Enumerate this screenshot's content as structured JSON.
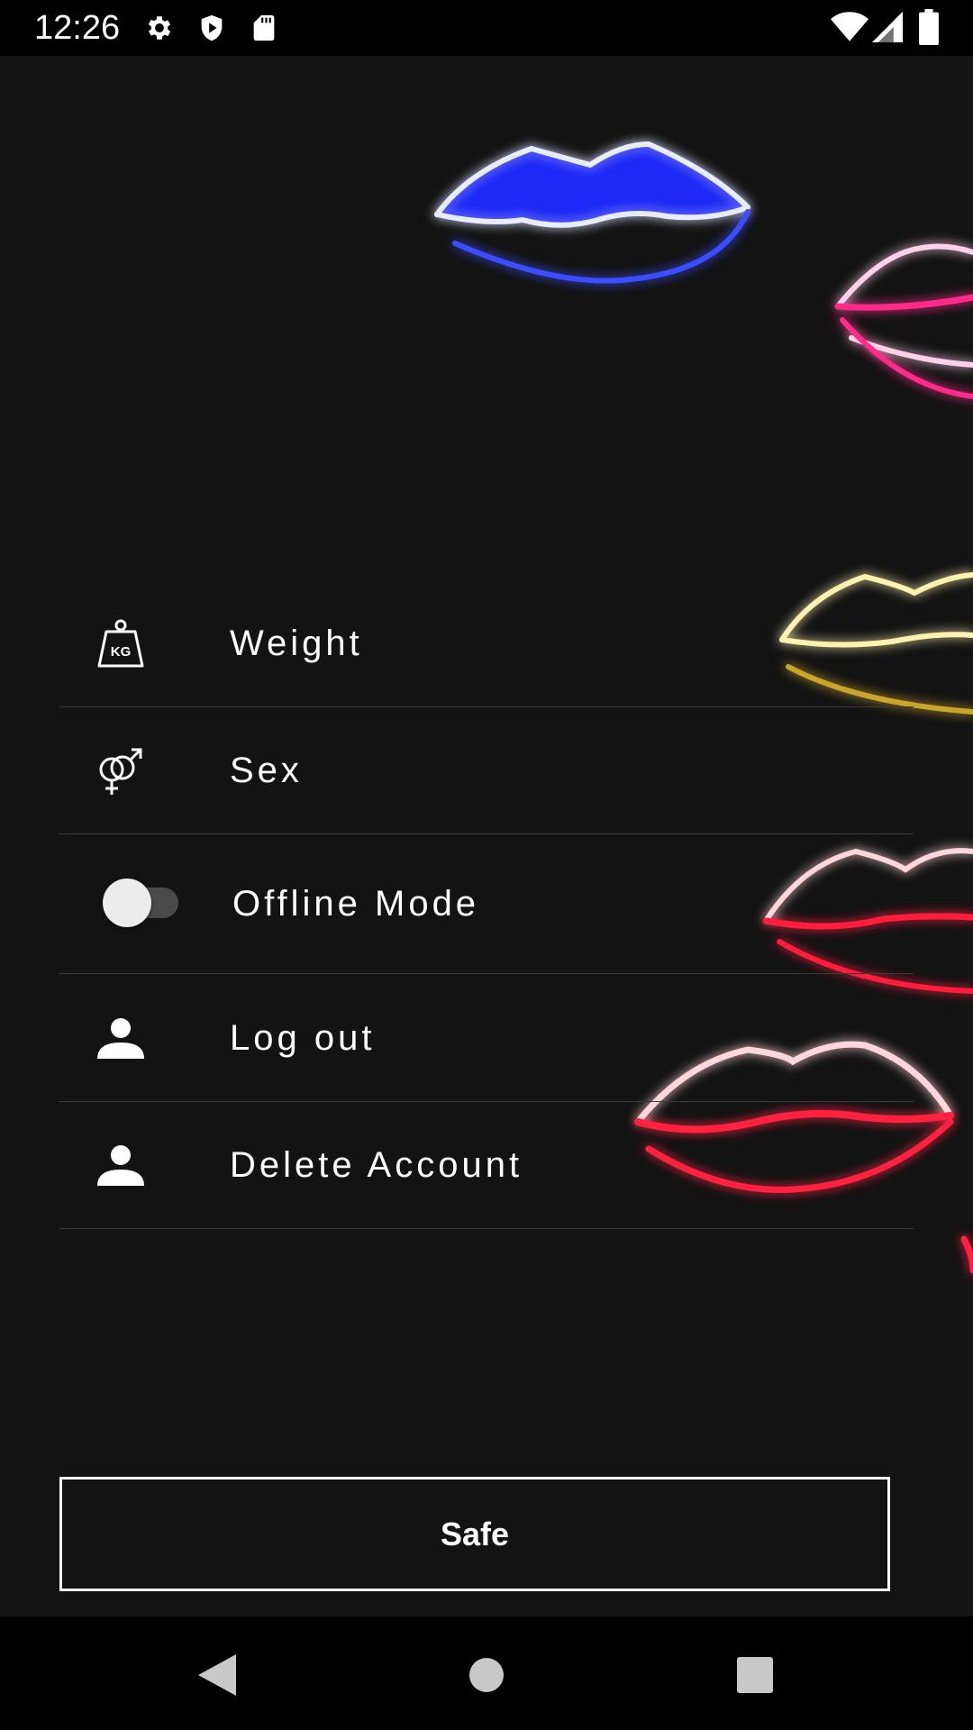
{
  "status_bar": {
    "time": "12:26",
    "icons": [
      "gear-icon",
      "shield-icon",
      "sd-card-icon",
      "wifi-icon",
      "signal-icon",
      "battery-icon"
    ]
  },
  "settings": {
    "items": [
      {
        "label": "Weight",
        "icon": "kg-weight-icon"
      },
      {
        "label": "Sex",
        "icon": "gender-icon"
      },
      {
        "label": "Offline Mode",
        "icon": "toggle-switch",
        "toggle_on": false
      },
      {
        "label": "Log out",
        "icon": "person-icon"
      },
      {
        "label": "Delete Account",
        "icon": "person-icon"
      }
    ]
  },
  "save_button": {
    "label": "Safe"
  },
  "nav_bar": {
    "icons": [
      "back-icon",
      "home-icon",
      "recents-icon"
    ]
  },
  "colors": {
    "background": "#131313",
    "bar": "#000000",
    "text": "#ffffff",
    "divider": "#3a3a3a",
    "neon_blue": "#3a4dff",
    "neon_pink": "#ff2a8a",
    "neon_yellow": "#f5e07a",
    "neon_red": "#ff1f3d"
  }
}
